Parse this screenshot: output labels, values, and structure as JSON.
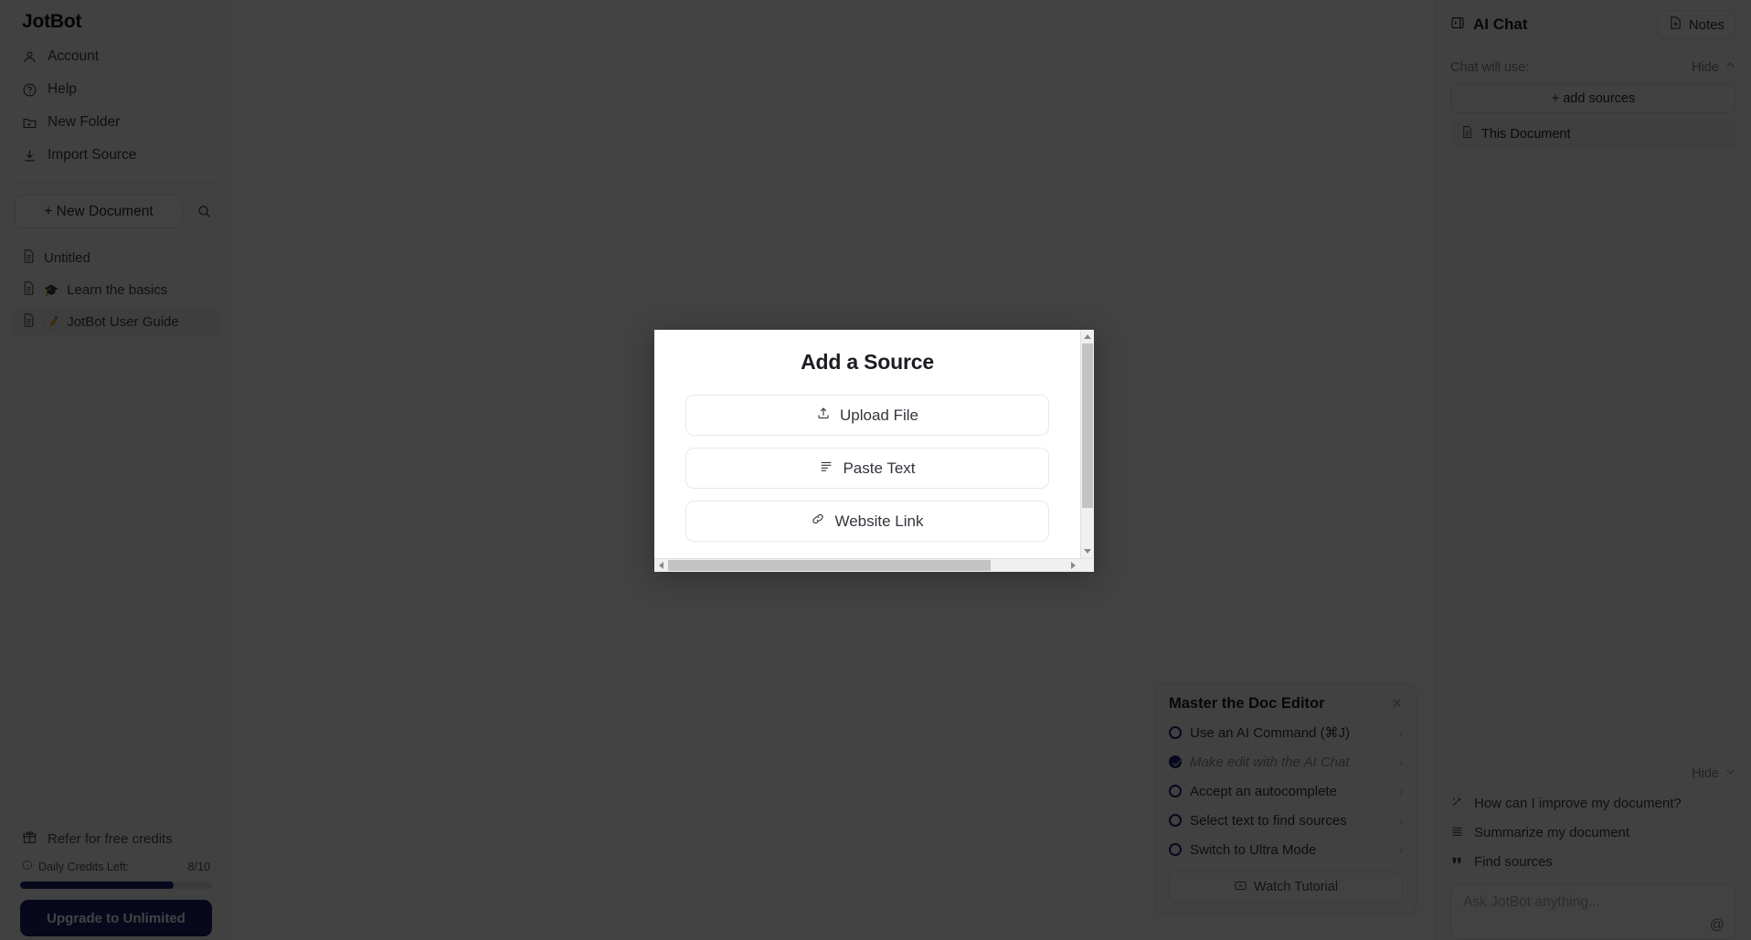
{
  "app": {
    "brand": "JotBot"
  },
  "sidebar": {
    "nav": [
      {
        "label": "Account",
        "icon": "user-icon"
      },
      {
        "label": "Help",
        "icon": "help-circle-icon"
      },
      {
        "label": "New Folder",
        "icon": "folder-plus-icon"
      },
      {
        "label": "Import Source",
        "icon": "download-icon"
      }
    ],
    "new_document_label": "+ New Document",
    "search_icon": "search-icon",
    "documents": [
      {
        "label": "Untitled",
        "emoji": "",
        "active": false
      },
      {
        "label": "Learn the basics",
        "emoji": "🎓",
        "active": false
      },
      {
        "label": "JotBot User Guide",
        "emoji": "📝",
        "active": true
      }
    ],
    "refer_label": "Refer for free credits",
    "credits_label": "Daily Credits Left:",
    "credits_value": "8/10",
    "credits_percent": 80,
    "upgrade_label": "Upgrade to Unlimited",
    "accent_color": "#1c1f6e"
  },
  "checklist": {
    "title": "Master the Doc Editor",
    "close_icon": "close-icon",
    "items": [
      {
        "label": "Use an AI Command (⌘J)",
        "done": false
      },
      {
        "label": "Make edit with the AI Chat",
        "done": true
      },
      {
        "label": "Accept an autocomplete",
        "done": false
      },
      {
        "label": "Select text to find sources",
        "done": false
      },
      {
        "label": "Switch to Ultra Mode",
        "done": false
      }
    ],
    "watch_label": "Watch Tutorial",
    "watch_icon": "play-video-icon"
  },
  "right_panel": {
    "title": "AI Chat",
    "title_icon": "chat-panel-icon",
    "notes_label": "Notes",
    "notes_icon": "note-add-icon",
    "sources_label": "Chat will use:",
    "hide_label": "Hide",
    "hide_icon": "chevron-up-icon",
    "add_sources_label": "+ add sources",
    "sources": [
      {
        "label": "This Document",
        "icon": "document-icon"
      }
    ],
    "hide_bottom_label": "Hide",
    "hide_bottom_icon": "chevron-down-icon",
    "suggestions": [
      {
        "label": "How can I improve my document?",
        "icon": "magic-wand-icon"
      },
      {
        "label": "Summarize my document",
        "icon": "lines-icon"
      },
      {
        "label": "Find sources",
        "icon": "quote-icon"
      }
    ],
    "ask_placeholder": "Ask JotBot anything...",
    "mention_icon": "at-icon"
  },
  "modal": {
    "title": "Add a Source",
    "options": [
      {
        "label": "Upload File",
        "icon": "upload-icon"
      },
      {
        "label": "Paste Text",
        "icon": "text-lines-icon"
      },
      {
        "label": "Website Link",
        "icon": "link-icon"
      }
    ],
    "scroll_up_icon": "scroll-up-arrow",
    "scroll_down_icon": "scroll-down-arrow",
    "scroll_left_icon": "scroll-left-arrow",
    "scroll_right_icon": "scroll-right-arrow"
  }
}
